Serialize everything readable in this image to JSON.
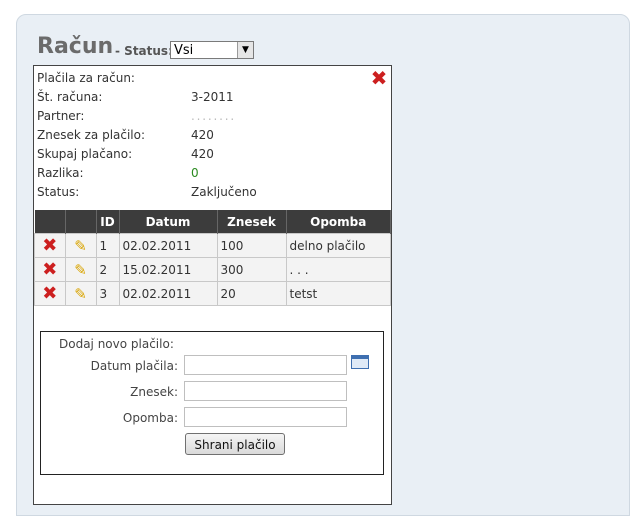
{
  "header": {
    "title": "Račun",
    "separator": "-",
    "status_label": "Status:",
    "status_value": "Vsi"
  },
  "details": {
    "heading": "Plačila za račun:",
    "fields": [
      {
        "label": "Št. računa:",
        "value": "3-2011"
      },
      {
        "label": "Partner:",
        "value": ". . . . . . . ."
      },
      {
        "label": "Znesek za plačilo:",
        "value": "420"
      },
      {
        "label": "Skupaj plačano:",
        "value": "420"
      },
      {
        "label": "Razlika:",
        "value": "0"
      },
      {
        "label": "Status:",
        "value": "Zaključeno"
      }
    ],
    "colors": {
      "difference": "#2a8a1f",
      "close": "#cc1f1f"
    }
  },
  "table": {
    "headers": [
      "",
      "",
      "ID",
      "Datum",
      "Znesek",
      "Opomba"
    ],
    "rows": [
      {
        "id": "1",
        "date": "02.02.2011",
        "amount": "100",
        "note": "delno plačilo"
      },
      {
        "id": "2",
        "date": "15.02.2011",
        "amount": "300",
        "note": ". . ."
      },
      {
        "id": "3",
        "date": "02.02.2011",
        "amount": "20",
        "note": "tetst"
      }
    ],
    "icons": {
      "delete": "delete-icon",
      "edit": "pencil-icon"
    }
  },
  "form": {
    "title": "Dodaj novo plačilo:",
    "date_label": "Datum plačila:",
    "amount_label": "Znesek:",
    "note_label": "Opomba:",
    "date_value": "",
    "amount_value": "",
    "note_value": "",
    "save_label": "Shrani plačilo"
  }
}
